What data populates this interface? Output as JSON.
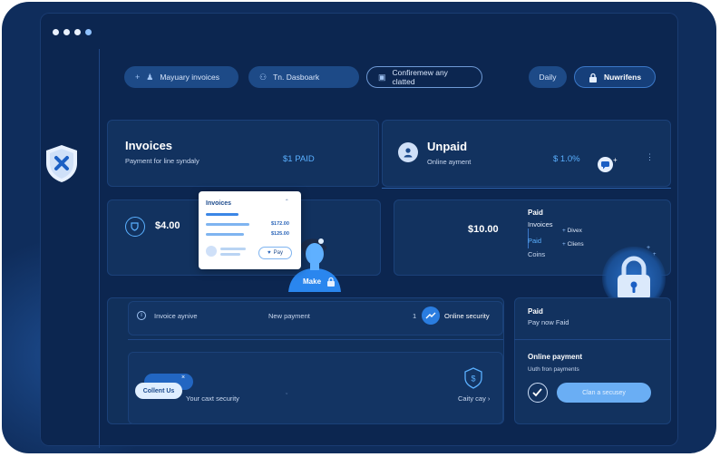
{
  "toolbar": {
    "item1": "Mayuary invoices",
    "item2": "Tn. Dasboark",
    "item3": "Confiremew any clatted",
    "daily": "Daily",
    "user": "Nuwrifens"
  },
  "invoices": {
    "title": "Invoices",
    "subtitle": "Payment for line syndaly",
    "amount": "$1 PAID"
  },
  "unpaid": {
    "title": "Unpaid",
    "subtitle": "Online ayment",
    "amount": "$ 1.0%"
  },
  "balance": {
    "amount": "$4.00"
  },
  "popup": {
    "title": "Invoices",
    "amt1": "$172.00",
    "amt2": "$125.00",
    "pay": "Pay"
  },
  "person": {
    "label": "Make"
  },
  "paid_panel": {
    "amount": "$10.00",
    "title": "Paid",
    "invoices": "Invoices",
    "paid": "Paid",
    "coins": "Coins",
    "legend1": "Divex",
    "legend2": "Cliens"
  },
  "list": {
    "info": "Invoice aynive",
    "new_payment": "New payment",
    "count": "1",
    "online_security": "Online security",
    "collent": "Collent Us",
    "your_security": "Your caxt security",
    "city": "Caity cay"
  },
  "right_panel": {
    "paid": "Paid",
    "paid_sub": "Pay now Faid",
    "online_payment": "Online payment",
    "online_sub": "Uuth fron payments",
    "button": "Clan a secusey"
  },
  "colors": {
    "accent": "#5ab0ff",
    "bg": "#0f2d5c",
    "panel": "#12325f"
  }
}
